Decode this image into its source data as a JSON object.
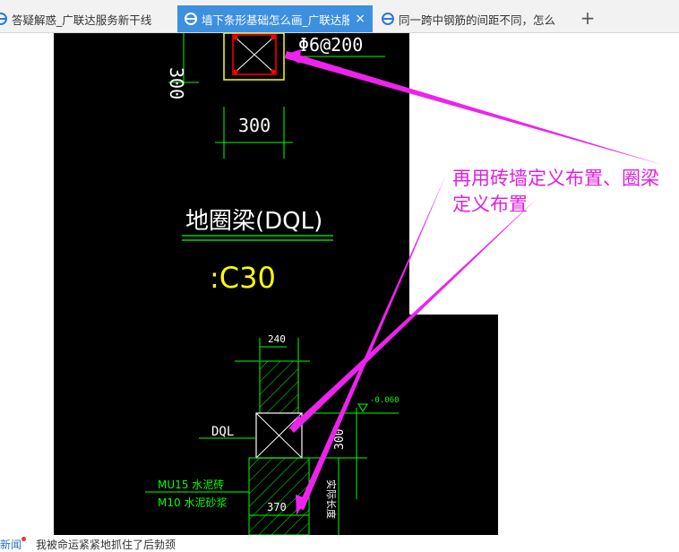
{
  "tabs": [
    {
      "title": "答疑解惑_广联达服务新干线",
      "active": false
    },
    {
      "title": "墙下条形基础怎么画_广联达服",
      "active": true
    },
    {
      "title": "同一跨中钢筋的间距不同，怎么",
      "active": false
    }
  ],
  "tab_close_symbol": "×",
  "new_tab_symbol": "+",
  "drawing": {
    "top_dim": "300",
    "side_dim": "300",
    "rebar_label": "Φ6@200",
    "beam_title": "地圈梁(DQL)",
    "concrete_grade": ":C30",
    "wall_dim": "240",
    "elevation": "-0.060",
    "dql_label": "DQL",
    "height_dim": "300",
    "brick_label": "MU15 水泥砖",
    "mortar_label": "M10 水泥砂浆",
    "base_dim": "370",
    "vertical_note": "实际长度"
  },
  "callout_text": "再用砖墙定义布置、圈梁定义布置",
  "status": {
    "left_label": "新闻",
    "news_text": "我被命运紧紧地抓住了后勃颈"
  },
  "colors": {
    "tab_active": "#3d8fe0",
    "cad_background": "#000000",
    "cad_green": "#00ff00",
    "cad_yellow": "#ffff00",
    "cad_white": "#ffffff",
    "cad_red": "#ff0000",
    "callout": "#e020e0"
  }
}
